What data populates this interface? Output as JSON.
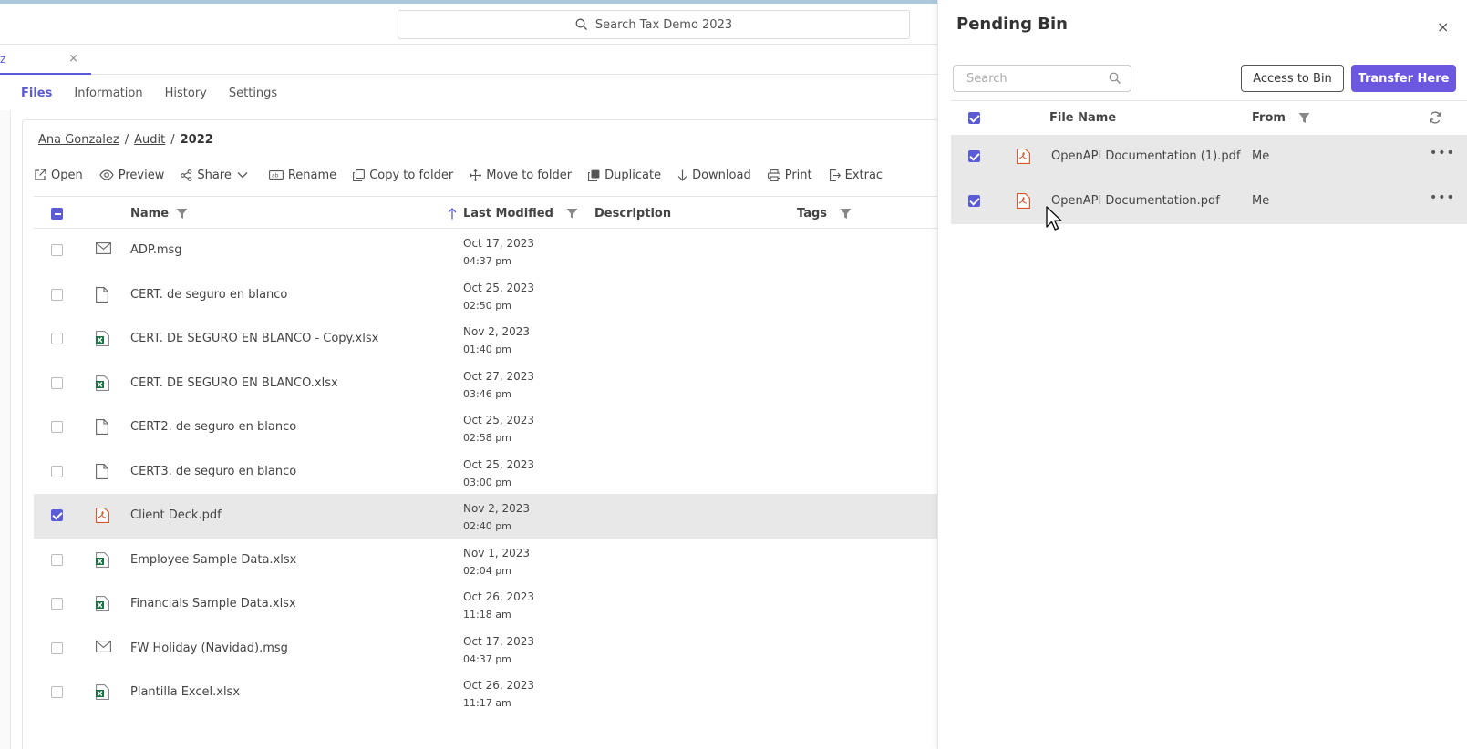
{
  "header": {
    "search_placeholder": "Search Tax Demo 2023"
  },
  "open_tab": {
    "label": "z",
    "close": "×"
  },
  "subtabs": [
    "Files",
    "Information",
    "History",
    "Settings"
  ],
  "breadcrumb": {
    "items": [
      "Ana Gonzalez",
      "Audit"
    ],
    "separator": "/",
    "current": "2022"
  },
  "toolbar": {
    "open": "Open",
    "preview": "Preview",
    "share": "Share",
    "rename": "Rename",
    "copy": "Copy to folder",
    "move": "Move to folder",
    "duplicate": "Duplicate",
    "download": "Download",
    "print": "Print",
    "extract": "Extrac"
  },
  "table": {
    "headers": {
      "name": "Name",
      "modified": "Last Modified",
      "description": "Description",
      "tags": "Tags"
    },
    "rows": [
      {
        "name": "ADP.msg",
        "type": "mail-icon",
        "date": "Oct 17, 2023",
        "time": "04:37 pm",
        "selected": false
      },
      {
        "name": "CERT. de seguro en blanco",
        "type": "file-icon",
        "date": "Oct 25, 2023",
        "time": "02:50 pm",
        "selected": false
      },
      {
        "name": "CERT. DE SEGURO EN BLANCO - Copy.xlsx",
        "type": "excel-icon",
        "date": "Nov 2, 2023",
        "time": "01:40 pm",
        "selected": false
      },
      {
        "name": "CERT. DE SEGURO EN BLANCO.xlsx",
        "type": "excel-icon",
        "date": "Oct 27, 2023",
        "time": "03:46 pm",
        "selected": false
      },
      {
        "name": "CERT2. de seguro en blanco",
        "type": "file-icon",
        "date": "Oct 25, 2023",
        "time": "02:58 pm",
        "selected": false
      },
      {
        "name": "CERT3. de seguro en blanco",
        "type": "file-icon",
        "date": "Oct 25, 2023",
        "time": "03:00 pm",
        "selected": false
      },
      {
        "name": "Client Deck.pdf",
        "type": "pdf-icon",
        "date": "Nov 2, 2023",
        "time": "02:40 pm",
        "selected": true
      },
      {
        "name": "Employee Sample Data.xlsx",
        "type": "excel-icon",
        "date": "Nov 1, 2023",
        "time": "02:04 pm",
        "selected": false
      },
      {
        "name": "Financials Sample Data.xlsx",
        "type": "excel-icon",
        "date": "Oct 26, 2023",
        "time": "11:18 am",
        "selected": false
      },
      {
        "name": "FW Holiday (Navidad).msg",
        "type": "mail-icon",
        "date": "Oct 17, 2023",
        "time": "04:37 pm",
        "selected": false
      },
      {
        "name": "Plantilla Excel.xlsx",
        "type": "excel-icon",
        "date": "Oct 26, 2023",
        "time": "11:17 am",
        "selected": false
      }
    ]
  },
  "pending_bin": {
    "title": "Pending Bin",
    "close": "×",
    "search_placeholder": "Search",
    "access_button": "Access to Bin",
    "transfer_button": "Transfer Here",
    "headers": {
      "file_name": "File Name",
      "from": "From"
    },
    "rows": [
      {
        "name": "OpenAPI Documentation (1).pdf",
        "from": "Me",
        "selected": true,
        "more": "•••"
      },
      {
        "name": "OpenAPI Documentation.pdf",
        "from": "Me",
        "selected": true,
        "more": "•••"
      }
    ]
  },
  "colors": {
    "accent": "#5b5bd6",
    "primary_button": "#6b57e0",
    "excel": "#1e7145",
    "pdf": "#d9542b"
  }
}
